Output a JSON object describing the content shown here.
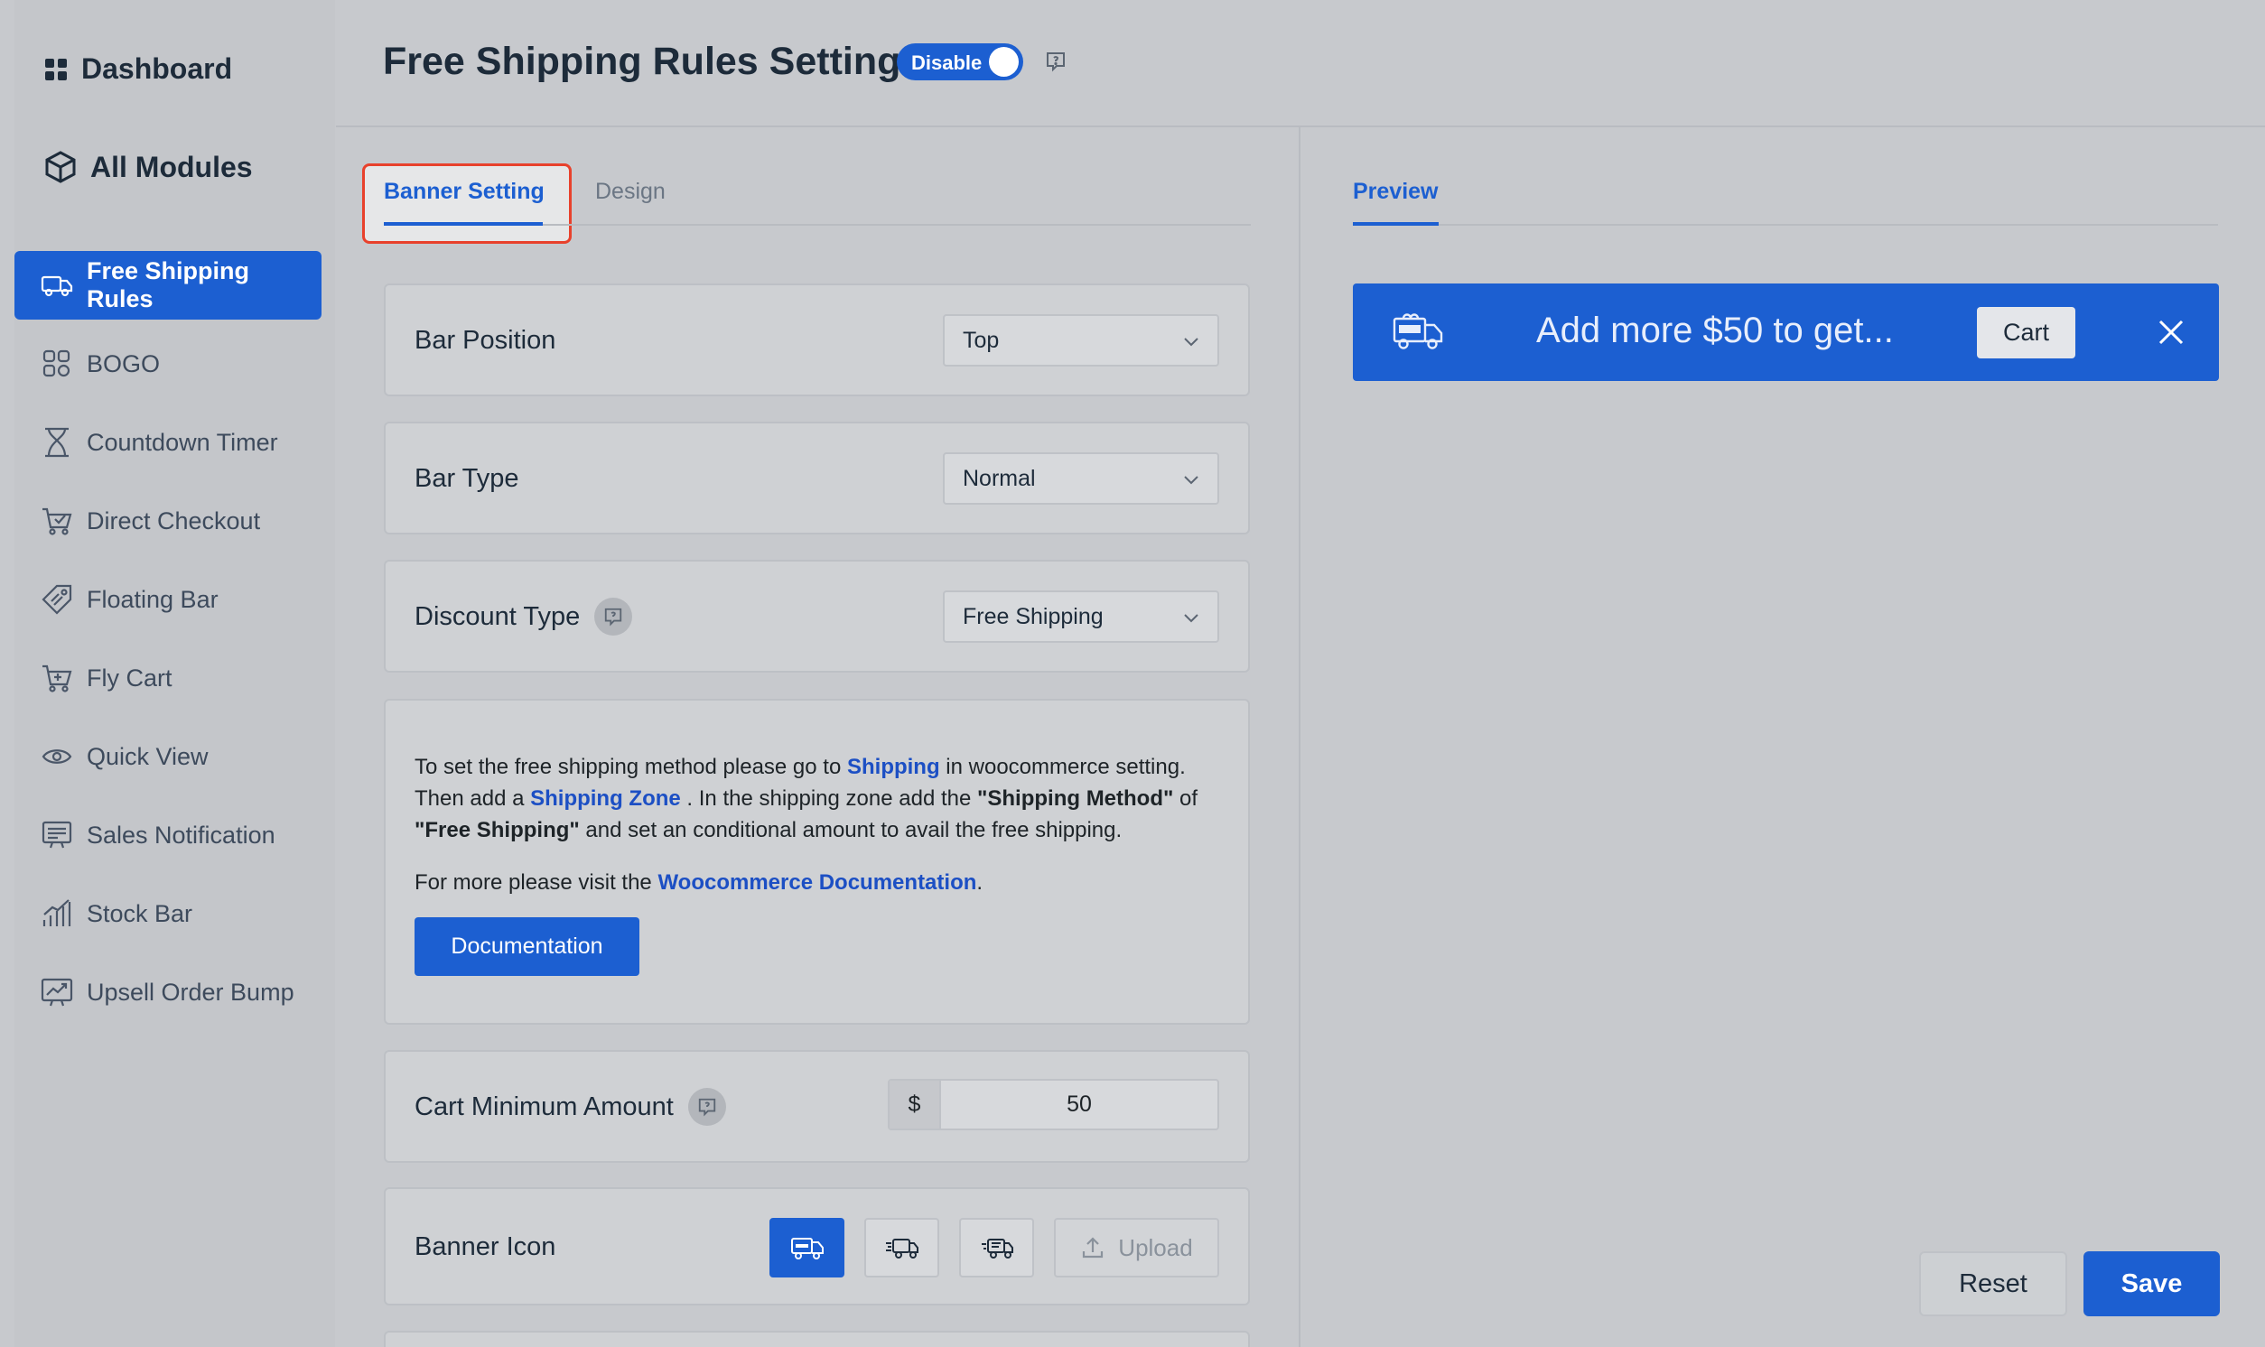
{
  "sidebar": {
    "dashboard_label": "Dashboard",
    "all_modules_label": "All Modules",
    "items": [
      {
        "label": "Free Shipping Rules",
        "icon": "truck-icon",
        "active": true
      },
      {
        "label": "BOGO",
        "icon": "bogo-icon"
      },
      {
        "label": "Countdown Timer",
        "icon": "hourglass-icon"
      },
      {
        "label": "Direct Checkout",
        "icon": "cart-check-icon"
      },
      {
        "label": "Floating Bar",
        "icon": "tag-icon"
      },
      {
        "label": "Fly Cart",
        "icon": "cart-icon"
      },
      {
        "label": "Quick View",
        "icon": "eye-icon"
      },
      {
        "label": "Sales Notification",
        "icon": "notification-icon"
      },
      {
        "label": "Stock Bar",
        "icon": "chart-icon"
      },
      {
        "label": "Upsell Order Bump",
        "icon": "trend-icon"
      }
    ]
  },
  "header": {
    "title": "Free Shipping Rules Setting",
    "toggle_label": "Disable"
  },
  "tabs": {
    "banner_setting": "Banner Setting",
    "design": "Design"
  },
  "settings": {
    "bar_position": {
      "label": "Bar Position",
      "value": "Top"
    },
    "bar_type": {
      "label": "Bar Type",
      "value": "Normal"
    },
    "discount_type": {
      "label": "Discount Type",
      "value": "Free Shipping"
    },
    "info": {
      "t1": "To set the free shipping method please go to ",
      "link1": "Shipping",
      "t2": " in woocommerce setting. Then add a ",
      "link2": "Shipping Zone",
      "t3": " . In the shipping zone add the ",
      "b1": "\"Shipping Method\"",
      "t4": " of ",
      "b2": "\"Free Shipping\"",
      "t5": " and set an conditional amount to avail the free shipping.",
      "more_prefix": "For more please visit the ",
      "more_link": "Woocommerce Documentation",
      "more_suffix": ".",
      "button": "Documentation"
    },
    "cart_minimum": {
      "label": "Cart Minimum Amount",
      "currency": "$",
      "value": "50"
    },
    "banner_icon": {
      "label": "Banner Icon",
      "upload": "Upload",
      "selected_index": 0
    }
  },
  "preview": {
    "tab": "Preview",
    "banner_text": "Add more $50 to get...",
    "cart_button": "Cart"
  },
  "actions": {
    "reset": "Reset",
    "save": "Save"
  },
  "colors": {
    "accent": "#1c5fd1",
    "highlight_border": "#e8412c"
  }
}
